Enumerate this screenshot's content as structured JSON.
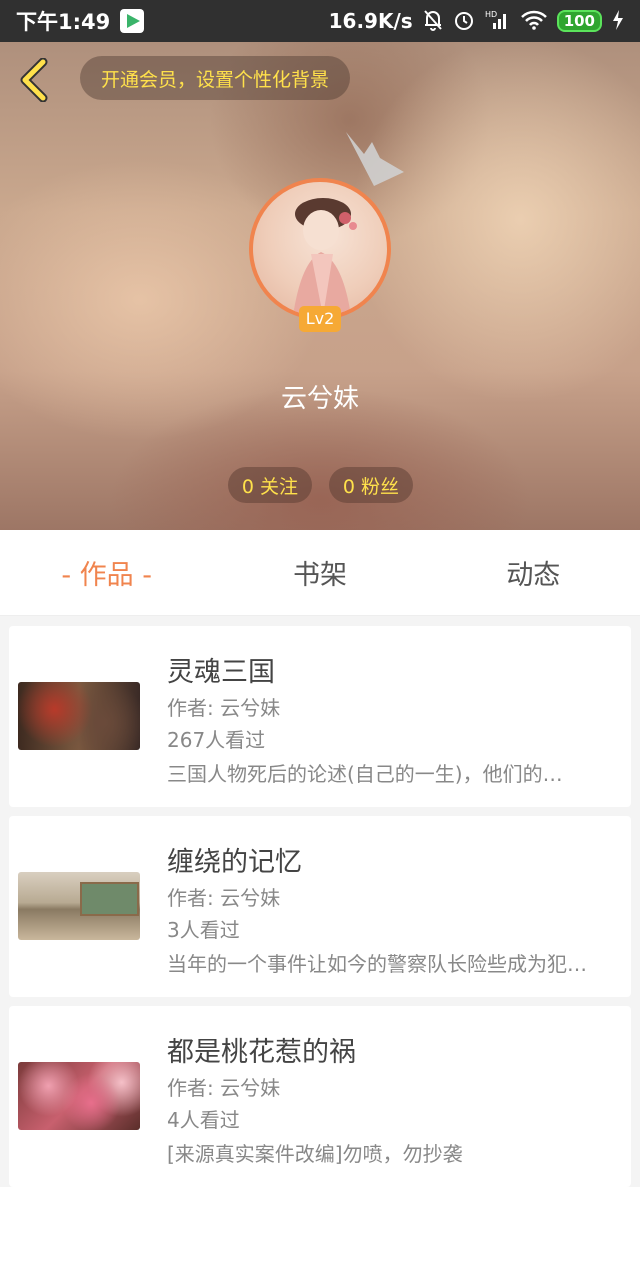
{
  "status_bar": {
    "time": "下午1:49",
    "network_speed": "16.9K/s",
    "battery": "100",
    "signal_label": "HD"
  },
  "header": {
    "vip_prompt": "开通会员，设置个性化背景",
    "level": "Lv2",
    "username": "云兮妹",
    "following": "0 关注",
    "followers": "0 粉丝"
  },
  "tabs": [
    {
      "label": "- 作品 -",
      "active": true
    },
    {
      "label": "书架",
      "active": false
    },
    {
      "label": "动态",
      "active": false
    }
  ],
  "works": [
    {
      "title": "灵魂三国",
      "author": "作者: 云兮妹",
      "views": "267人看过",
      "description": "三国人物死后的论述(自己的一生)，他们的…"
    },
    {
      "title": "缠绕的记忆",
      "author": "作者: 云兮妹",
      "views": "3人看过",
      "description": "当年的一个事件让如今的警察队长险些成为犯…"
    },
    {
      "title": "都是桃花惹的祸",
      "author": "作者: 云兮妹",
      "views": "4人看过",
      "description": "[来源真实案件改编]勿喷，勿抄袭"
    }
  ],
  "colors": {
    "accent": "#f0844e",
    "vip_text": "#ffe14b",
    "level_badge": "#f6a935"
  }
}
